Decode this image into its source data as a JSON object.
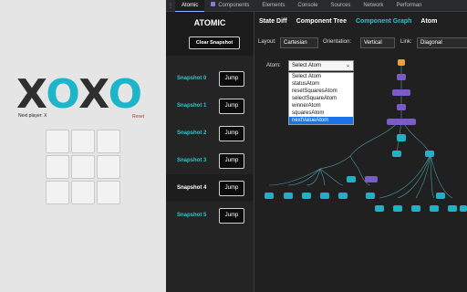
{
  "game": {
    "logo_letters": [
      "X",
      "O",
      "X",
      "O"
    ],
    "status": "Next player: X",
    "reset_label": "Reset",
    "board": [
      "",
      "",
      "",
      "",
      "",
      "",
      "",
      "",
      ""
    ]
  },
  "devtools": {
    "tabs": [
      {
        "label": "Atomic",
        "active": true
      },
      {
        "label": "Components",
        "icon": "react-icon"
      },
      {
        "label": "Elements"
      },
      {
        "label": "Console"
      },
      {
        "label": "Sources"
      },
      {
        "label": "Network"
      },
      {
        "label": "Performan"
      }
    ]
  },
  "atomic": {
    "title": "ATOMIC",
    "clear_label": "Clear Snapshot",
    "snapshots": [
      {
        "label": "Snapshot 0",
        "jump": "Jump"
      },
      {
        "label": "Snapshot 1",
        "jump": "Jump"
      },
      {
        "label": "Snapshot 2",
        "jump": "Jump"
      },
      {
        "label": "Snapshot 3",
        "jump": "Jump"
      },
      {
        "label": "Snapshot 4",
        "jump": "Jump",
        "selected": true
      },
      {
        "label": "Snapshot 5",
        "jump": "Jump"
      }
    ],
    "subtabs": [
      "State Diff",
      "Component Tree",
      "Component Graph",
      "Atom"
    ],
    "active_subtab": "Component Graph",
    "controls": {
      "layout_label": "Layout:",
      "layout_value": "Cartesian",
      "orientation_label": "Orientation:",
      "orientation_value": "Vertical",
      "link_label": "Link:",
      "link_value": "Diagonal"
    },
    "atom_label": "Atom:",
    "atom_select": "Select Atom",
    "atom_options": [
      "Select Atom",
      "statusAtom",
      "resetSquaresAtom",
      "selectSquareAtom",
      "winnerAtom",
      "squaresAtom",
      "nextValueAtom"
    ],
    "highlighted_option": "nextValueAtom"
  },
  "colors": {
    "accent": "#36c0d1",
    "logo_x": "#2f2f2f",
    "logo_o": "#1db5c9",
    "node_orange": "#e6a23c",
    "node_purple": "#7b5cc4",
    "node_teal": "#1fb2c4"
  }
}
